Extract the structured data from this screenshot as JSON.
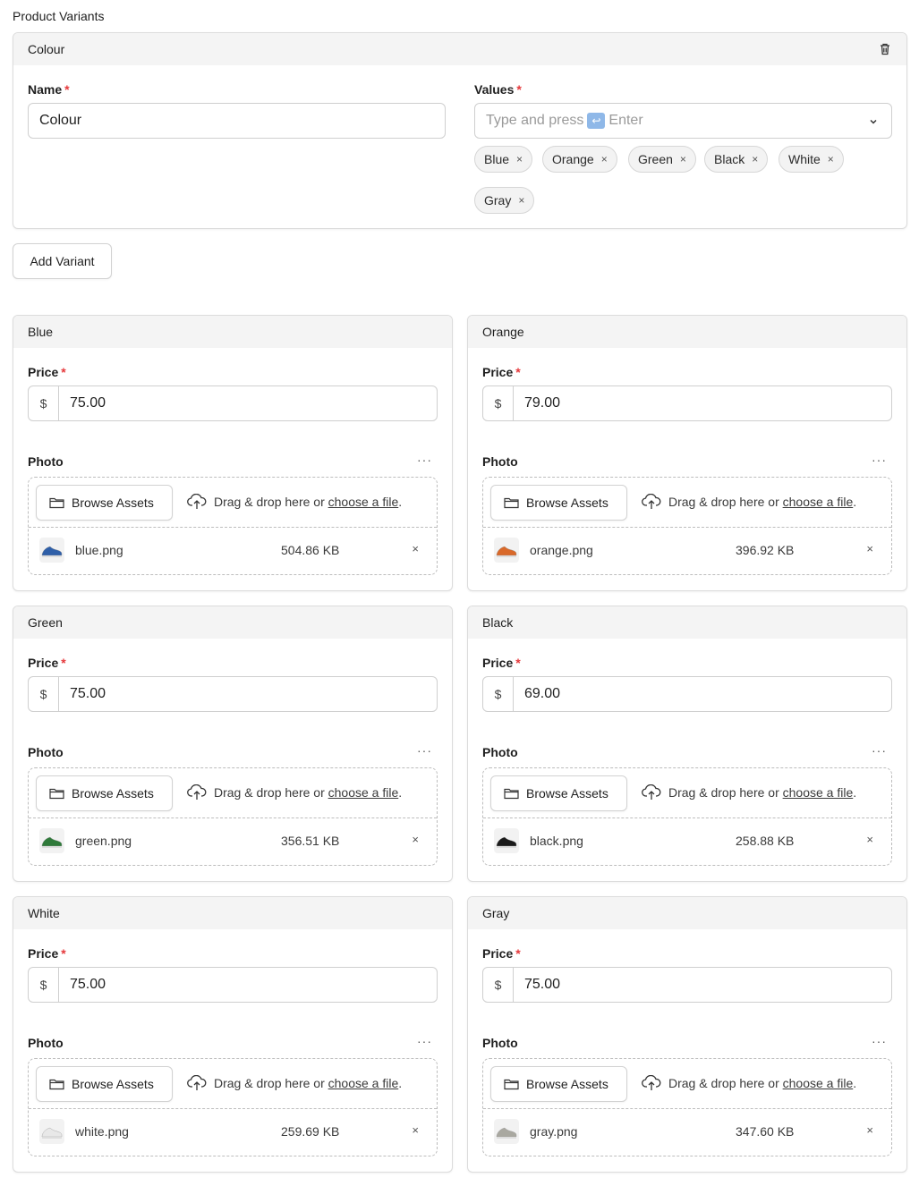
{
  "section_title": "Product Variants",
  "option_card": {
    "title": "Colour",
    "name_label": "Name",
    "name_value": "Colour",
    "values_label": "Values",
    "values_placeholder_prefix": "Type and press",
    "values_placeholder_key": "↩",
    "values_placeholder_suffix": "Enter",
    "tags": [
      "Blue",
      "Orange",
      "Green",
      "Black",
      "White",
      "Gray"
    ]
  },
  "add_variant_label": "Add Variant",
  "variant_common": {
    "price_label": "Price",
    "currency": "$",
    "photo_label": "Photo",
    "browse_label": "Browse Assets",
    "drag_text": "Drag & drop here or",
    "choose_link": "choose a file",
    "period": ".",
    "more": "···",
    "remove": "×"
  },
  "variants": [
    {
      "name": "Blue",
      "price": "75.00",
      "file": "blue.png",
      "size": "504.86 KB",
      "shoe_color": "#2f5fa8"
    },
    {
      "name": "Orange",
      "price": "79.00",
      "file": "orange.png",
      "size": "396.92 KB",
      "shoe_color": "#d9692a"
    },
    {
      "name": "Green",
      "price": "75.00",
      "file": "green.png",
      "size": "356.51 KB",
      "shoe_color": "#2f7a3a"
    },
    {
      "name": "Black",
      "price": "69.00",
      "file": "black.png",
      "size": "258.88 KB",
      "shoe_color": "#1b1b1b"
    },
    {
      "name": "White",
      "price": "75.00",
      "file": "white.png",
      "size": "259.69 KB",
      "shoe_color": "#e8e8e8"
    },
    {
      "name": "Gray",
      "price": "75.00",
      "file": "gray.png",
      "size": "347.60 KB",
      "shoe_color": "#a9a8a0"
    }
  ],
  "colors": {
    "required": "#e5383b",
    "header_bg": "#f4f4f4"
  }
}
